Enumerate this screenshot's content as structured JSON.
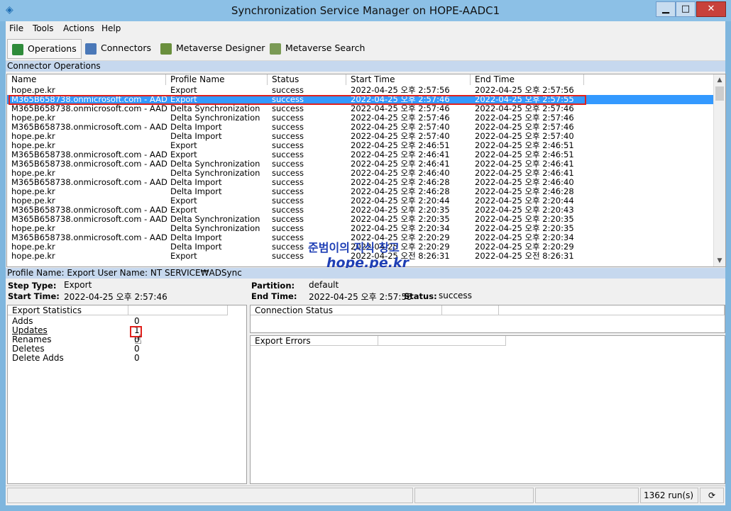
{
  "window": {
    "title": "Synchronization Service Manager on HOPE-AADC1",
    "minimize": "▁",
    "maximize": "□",
    "close": "✕",
    "app_icon": "sync-diamond-icon"
  },
  "menu": [
    "File",
    "Tools",
    "Actions",
    "Help"
  ],
  "toolbar": [
    {
      "label": "Operations",
      "icon": "operations-icon",
      "color": "#2e8b3a"
    },
    {
      "label": "Connectors",
      "icon": "connectors-icon",
      "color": "#4a78b8"
    },
    {
      "label": "Metaverse Designer",
      "icon": "metaverse-designer-icon",
      "color": "#6a8f3d"
    },
    {
      "label": "Metaverse Search",
      "icon": "metaverse-search-icon",
      "color": "#7a9a55"
    }
  ],
  "operations": {
    "section_title": "Connector Operations",
    "columns": [
      "Name",
      "Profile Name",
      "Status",
      "Start Time",
      "End Time"
    ],
    "rows": [
      [
        "hope.pe.kr",
        "Export",
        "success",
        "2022-04-25 오후 2:57:56",
        "2022-04-25 오후 2:57:56"
      ],
      [
        "M365B658738.onmicrosoft.com - AAD",
        "Export",
        "success",
        "2022-04-25 오후 2:57:46",
        "2022-04-25 오후 2:57:55"
      ],
      [
        "M365B658738.onmicrosoft.com - AAD",
        "Delta Synchronization",
        "success",
        "2022-04-25 오후 2:57:46",
        "2022-04-25 오후 2:57:46"
      ],
      [
        "hope.pe.kr",
        "Delta Synchronization",
        "success",
        "2022-04-25 오후 2:57:46",
        "2022-04-25 오후 2:57:46"
      ],
      [
        "M365B658738.onmicrosoft.com - AAD",
        "Delta Import",
        "success",
        "2022-04-25 오후 2:57:40",
        "2022-04-25 오후 2:57:46"
      ],
      [
        "hope.pe.kr",
        "Delta Import",
        "success",
        "2022-04-25 오후 2:57:40",
        "2022-04-25 오후 2:57:40"
      ],
      [
        "hope.pe.kr",
        "Export",
        "success",
        "2022-04-25 오후 2:46:51",
        "2022-04-25 오후 2:46:51"
      ],
      [
        "M365B658738.onmicrosoft.com - AAD",
        "Export",
        "success",
        "2022-04-25 오후 2:46:41",
        "2022-04-25 오후 2:46:51"
      ],
      [
        "M365B658738.onmicrosoft.com - AAD",
        "Delta Synchronization",
        "success",
        "2022-04-25 오후 2:46:41",
        "2022-04-25 오후 2:46:41"
      ],
      [
        "hope.pe.kr",
        "Delta Synchronization",
        "success",
        "2022-04-25 오후 2:46:40",
        "2022-04-25 오후 2:46:41"
      ],
      [
        "M365B658738.onmicrosoft.com - AAD",
        "Delta Import",
        "success",
        "2022-04-25 오후 2:46:28",
        "2022-04-25 오후 2:46:40"
      ],
      [
        "hope.pe.kr",
        "Delta Import",
        "success",
        "2022-04-25 오후 2:46:28",
        "2022-04-25 오후 2:46:28"
      ],
      [
        "hope.pe.kr",
        "Export",
        "success",
        "2022-04-25 오후 2:20:44",
        "2022-04-25 오후 2:20:44"
      ],
      [
        "M365B658738.onmicrosoft.com - AAD",
        "Export",
        "success",
        "2022-04-25 오후 2:20:35",
        "2022-04-25 오후 2:20:43"
      ],
      [
        "M365B658738.onmicrosoft.com - AAD",
        "Delta Synchronization",
        "success",
        "2022-04-25 오후 2:20:35",
        "2022-04-25 오후 2:20:35"
      ],
      [
        "hope.pe.kr",
        "Delta Synchronization",
        "success",
        "2022-04-25 오후 2:20:34",
        "2022-04-25 오후 2:20:35"
      ],
      [
        "M365B658738.onmicrosoft.com - AAD",
        "Delta Import",
        "success",
        "2022-04-25 오후 2:20:29",
        "2022-04-25 오후 2:20:34"
      ],
      [
        "hope.pe.kr",
        "Delta Import",
        "success",
        "2022-04-25 오후 2:20:29",
        "2022-04-25 오후 2:20:29"
      ],
      [
        "hope.pe.kr",
        "Export",
        "success",
        "2022-04-25 오전 8:26:31",
        "2022-04-25 오전 8:26:31"
      ]
    ],
    "selected_index": 1,
    "selection_color": "#3399ff",
    "highlight_color": "#e0201c"
  },
  "watermark": {
    "line1": "준범이의 지식 창고",
    "line2": "hope.pe.kr"
  },
  "detail": {
    "profile_line": "Profile Name: Export  User Name: NT SERVICE₩ADSync",
    "step_type_label": "Step Type:",
    "step_type": "Export",
    "start_time_label": "Start Time:",
    "start_time": "2022-04-25 오후 2:57:46",
    "partition_label": "Partition:",
    "partition": "default",
    "end_time_label": "End Time:",
    "end_time": "2022-04-25 오후 2:57:55",
    "status_label": "Status:",
    "status": "success"
  },
  "export_stats": {
    "title": "Export Statistics",
    "rows": [
      {
        "label": "Adds",
        "value": "0"
      },
      {
        "label": "Updates",
        "value": "1"
      },
      {
        "label": "Renames",
        "value": "0"
      },
      {
        "label": "Deletes",
        "value": "0"
      },
      {
        "label": "Delete Adds",
        "value": "0"
      }
    ]
  },
  "connection_status": {
    "title": "Connection Status"
  },
  "export_errors": {
    "title": "Export Errors"
  },
  "statusbar": {
    "runs": "1362 run(s)"
  }
}
